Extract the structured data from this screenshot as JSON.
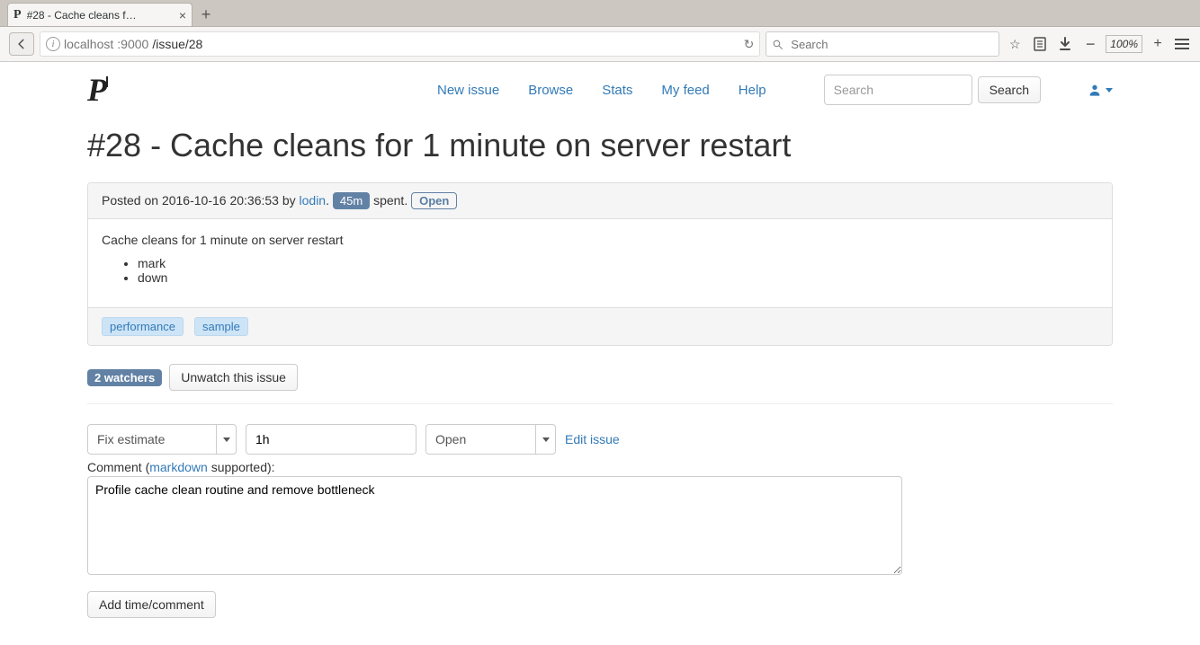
{
  "browser": {
    "tab_title": "#28 - Cache cleans f…",
    "url_host": "localhost",
    "url_port": ":9000",
    "url_path": "/issue/28",
    "search_placeholder": "Search",
    "zoom": "100%"
  },
  "nav": {
    "brand": "P",
    "links": [
      "New issue",
      "Browse",
      "Stats",
      "My feed",
      "Help"
    ],
    "search_placeholder": "Search",
    "search_button": "Search"
  },
  "issue": {
    "title": "#28 - Cache cleans for 1 minute on server restart",
    "posted_prefix": "Posted on ",
    "posted_at": "2016-10-16 20:36:53",
    "posted_by_text": " by ",
    "author": "lodin",
    "time_spent": "45m",
    "spent_suffix": " spent. ",
    "status": "Open",
    "body_line": "Cache cleans for 1 minute on server restart",
    "bullets": [
      "mark",
      "down"
    ],
    "tags": [
      "performance",
      "sample"
    ]
  },
  "watchers": {
    "count_label": "2 watchers",
    "unwatch": "Unwatch this issue"
  },
  "form": {
    "action_select": "Fix estimate",
    "time_value": "1h",
    "status_select": "Open",
    "edit_link": "Edit issue",
    "comment_label_pre": "Comment (",
    "comment_label_link": "markdown",
    "comment_label_post": " supported):",
    "comment_value": "Profile cache clean routine and remove bottleneck",
    "submit": "Add time/comment"
  }
}
